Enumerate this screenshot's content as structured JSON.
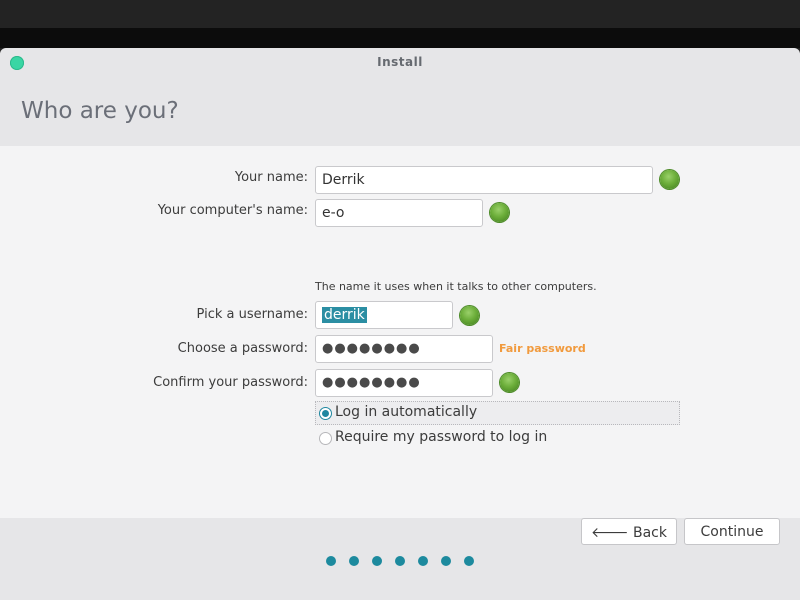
{
  "window": {
    "title": "Install"
  },
  "page": {
    "heading": "Who are you?"
  },
  "form": {
    "name": {
      "label": "Your name:",
      "value": "Derrik"
    },
    "computer_name": {
      "label": "Your computer's name:",
      "value": "e-o",
      "hint": "The name it uses when it talks to other computers."
    },
    "username": {
      "label": "Pick a username:",
      "value": "derrik"
    },
    "password": {
      "label": "Choose a password:",
      "value": "●●●●●●●●",
      "strength": "Fair password"
    },
    "confirm_password": {
      "label": "Confirm your password:",
      "value": "●●●●●●●●"
    },
    "login_options": [
      {
        "label": "Log in automatically",
        "checked": true
      },
      {
        "label": "Require my password to log in",
        "checked": false
      }
    ]
  },
  "buttons": {
    "back": "🡐 Back",
    "continue": "Continue"
  },
  "progress": {
    "steps_total": 7
  },
  "colors": {
    "accent": "#1d8a9e",
    "close": "#3ad6a4",
    "ok": "#6cae3a",
    "password_strength": "#f19a3d"
  },
  "icons": {
    "back": "arrow-left-icon",
    "valid": "check-ok-icon"
  }
}
